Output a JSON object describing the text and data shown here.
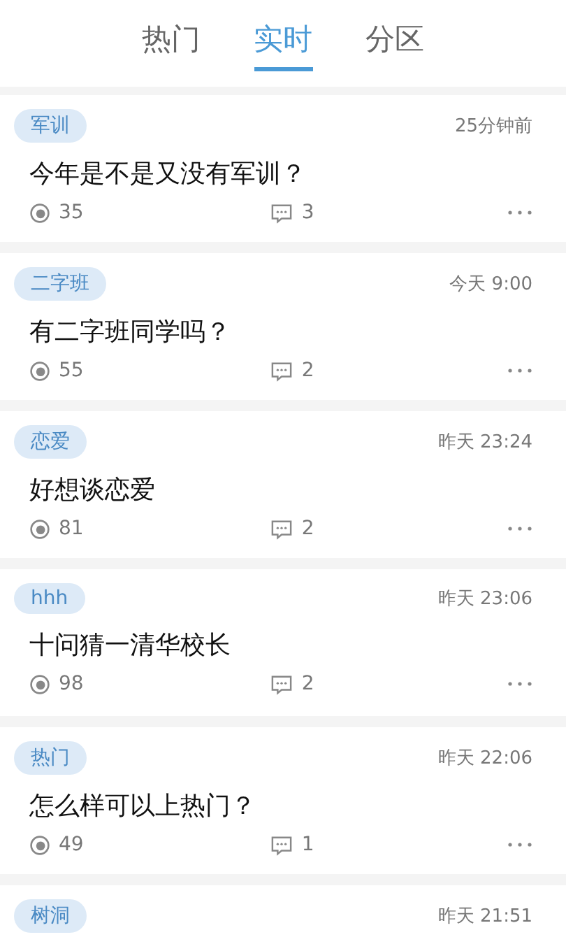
{
  "tabs": [
    {
      "label": "热门",
      "selected": false
    },
    {
      "label": "实时",
      "selected": true
    },
    {
      "label": "分区",
      "selected": false
    }
  ],
  "posts": [
    {
      "tag": "军训",
      "time": "25分钟前",
      "title": "今年是不是又没有军训？",
      "views": "35",
      "comments": "3"
    },
    {
      "tag": "二字班",
      "time": "今天 9:00",
      "title": "有二字班同学吗？",
      "views": "55",
      "comments": "2"
    },
    {
      "tag": "恋爱",
      "time": "昨天 23:24",
      "title": "好想谈恋爱",
      "views": "81",
      "comments": "2"
    },
    {
      "tag": "hhh",
      "time": "昨天 23:06",
      "title": "十问猜一清华校长",
      "views": "98",
      "comments": "2"
    },
    {
      "tag": "热门",
      "time": "昨天 22:06",
      "title": "怎么样可以上热门？",
      "views": "49",
      "comments": "1"
    },
    {
      "tag": "树洞",
      "time": "昨天 21:51"
    }
  ]
}
